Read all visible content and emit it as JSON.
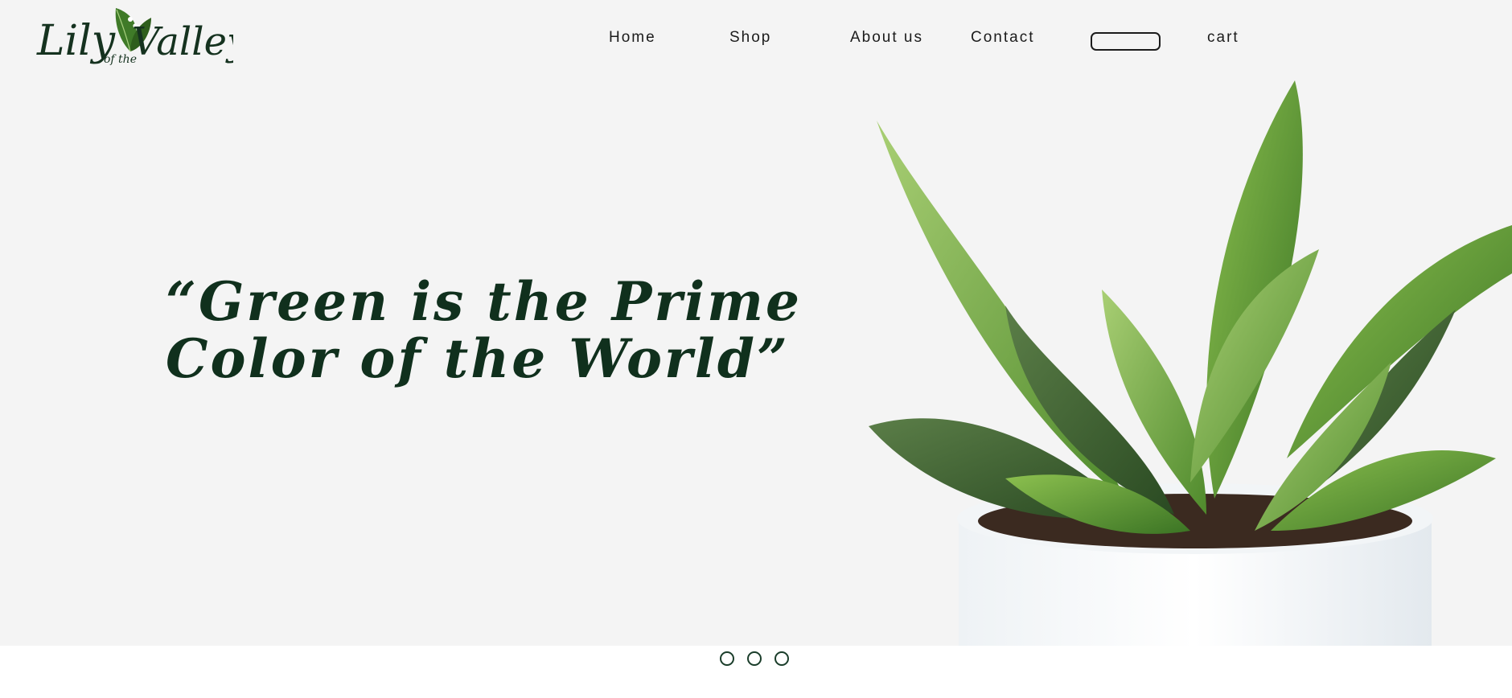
{
  "brand": {
    "logo_word_1": "Lily",
    "logo_word_2": "of the",
    "logo_word_3": "Valley",
    "logo_icon": "leaf-icon"
  },
  "nav": {
    "items": [
      {
        "label": "Home"
      },
      {
        "label": "Shop"
      },
      {
        "label": "About us"
      },
      {
        "label": "Contact"
      }
    ],
    "search": {
      "value": "",
      "placeholder": ""
    },
    "cart_label": "cart"
  },
  "hero": {
    "headline_line_1": "“Green is the Prime",
    "headline_line_2": "Color of the World”",
    "image": "potted-snake-plant"
  },
  "carousel": {
    "slide_count": 3,
    "dots": [
      "",
      "",
      ""
    ]
  },
  "colors": {
    "hero_background": "#f4f4f4",
    "headline": "#10301d",
    "dot_border": "#1a3d2a",
    "nav_text": "#1b1b1b"
  }
}
